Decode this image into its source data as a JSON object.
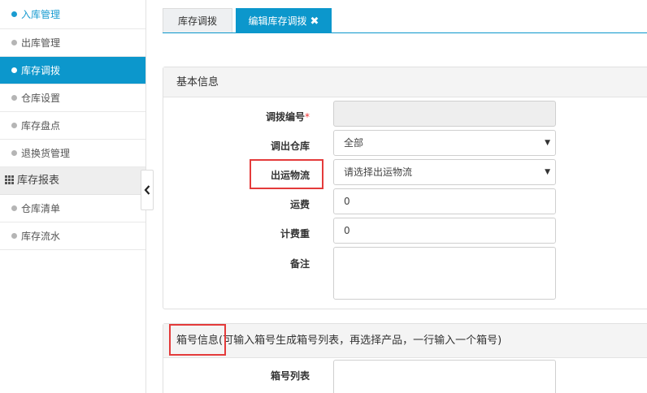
{
  "sidebar": {
    "items": [
      {
        "label": "入库管理"
      },
      {
        "label": "出库管理"
      },
      {
        "label": "库存调拨"
      },
      {
        "label": "仓库设置"
      },
      {
        "label": "库存盘点"
      },
      {
        "label": "退换货管理"
      }
    ],
    "group": {
      "label": "库存报表"
    },
    "group_items": [
      {
        "label": "仓库清单"
      },
      {
        "label": "库存流水"
      }
    ]
  },
  "tabs": [
    {
      "label": "库存调拨"
    },
    {
      "label": "编辑库存调拨",
      "close": "✖"
    }
  ],
  "basic_info": {
    "title": "基本信息",
    "fields": {
      "transfer_no": {
        "label": "调拨编号",
        "required": "*",
        "value": ""
      },
      "out_warehouse": {
        "label": "调出仓库",
        "value": "全部"
      },
      "out_logistics": {
        "label": "出运物流",
        "value": "请选择出运物流"
      },
      "freight": {
        "label": "运费",
        "value": "0"
      },
      "billing_weight": {
        "label": "计费重",
        "value": "0"
      },
      "remarks": {
        "label": "备注",
        "value": ""
      }
    }
  },
  "box_info": {
    "title": "箱号信息",
    "hint": "(可输入箱号生成箱号列表，再选择产品，一行输入一个箱号)",
    "fields": {
      "box_list": {
        "label": "箱号列表",
        "value": ""
      }
    }
  },
  "icons": {
    "collapse": "chevron-left-icon",
    "select_caret": "caret-down-icon",
    "group": "grid-icon",
    "tab_close": "close-icon"
  },
  "colors": {
    "accent": "#0c97cc",
    "highlight": "#e43b3b",
    "required": "#e33333"
  }
}
